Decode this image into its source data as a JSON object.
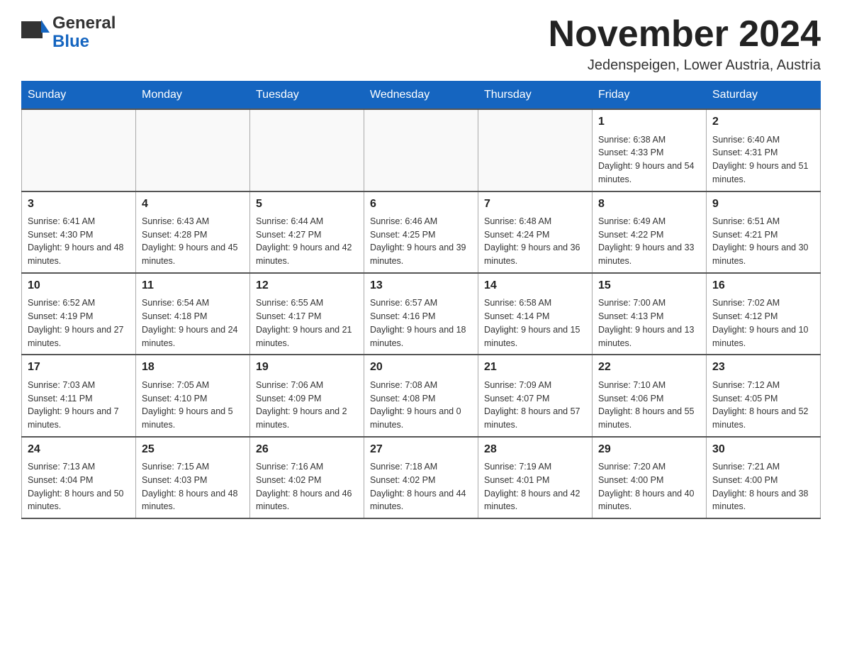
{
  "header": {
    "logo_text_general": "General",
    "logo_text_blue": "Blue",
    "month_year": "November 2024",
    "location": "Jedenspeigen, Lower Austria, Austria"
  },
  "weekdays": [
    "Sunday",
    "Monday",
    "Tuesday",
    "Wednesday",
    "Thursday",
    "Friday",
    "Saturday"
  ],
  "weeks": [
    {
      "days": [
        {
          "num": "",
          "info": ""
        },
        {
          "num": "",
          "info": ""
        },
        {
          "num": "",
          "info": ""
        },
        {
          "num": "",
          "info": ""
        },
        {
          "num": "",
          "info": ""
        },
        {
          "num": "1",
          "info": "Sunrise: 6:38 AM\nSunset: 4:33 PM\nDaylight: 9 hours and 54 minutes."
        },
        {
          "num": "2",
          "info": "Sunrise: 6:40 AM\nSunset: 4:31 PM\nDaylight: 9 hours and 51 minutes."
        }
      ]
    },
    {
      "days": [
        {
          "num": "3",
          "info": "Sunrise: 6:41 AM\nSunset: 4:30 PM\nDaylight: 9 hours and 48 minutes."
        },
        {
          "num": "4",
          "info": "Sunrise: 6:43 AM\nSunset: 4:28 PM\nDaylight: 9 hours and 45 minutes."
        },
        {
          "num": "5",
          "info": "Sunrise: 6:44 AM\nSunset: 4:27 PM\nDaylight: 9 hours and 42 minutes."
        },
        {
          "num": "6",
          "info": "Sunrise: 6:46 AM\nSunset: 4:25 PM\nDaylight: 9 hours and 39 minutes."
        },
        {
          "num": "7",
          "info": "Sunrise: 6:48 AM\nSunset: 4:24 PM\nDaylight: 9 hours and 36 minutes."
        },
        {
          "num": "8",
          "info": "Sunrise: 6:49 AM\nSunset: 4:22 PM\nDaylight: 9 hours and 33 minutes."
        },
        {
          "num": "9",
          "info": "Sunrise: 6:51 AM\nSunset: 4:21 PM\nDaylight: 9 hours and 30 minutes."
        }
      ]
    },
    {
      "days": [
        {
          "num": "10",
          "info": "Sunrise: 6:52 AM\nSunset: 4:19 PM\nDaylight: 9 hours and 27 minutes."
        },
        {
          "num": "11",
          "info": "Sunrise: 6:54 AM\nSunset: 4:18 PM\nDaylight: 9 hours and 24 minutes."
        },
        {
          "num": "12",
          "info": "Sunrise: 6:55 AM\nSunset: 4:17 PM\nDaylight: 9 hours and 21 minutes."
        },
        {
          "num": "13",
          "info": "Sunrise: 6:57 AM\nSunset: 4:16 PM\nDaylight: 9 hours and 18 minutes."
        },
        {
          "num": "14",
          "info": "Sunrise: 6:58 AM\nSunset: 4:14 PM\nDaylight: 9 hours and 15 minutes."
        },
        {
          "num": "15",
          "info": "Sunrise: 7:00 AM\nSunset: 4:13 PM\nDaylight: 9 hours and 13 minutes."
        },
        {
          "num": "16",
          "info": "Sunrise: 7:02 AM\nSunset: 4:12 PM\nDaylight: 9 hours and 10 minutes."
        }
      ]
    },
    {
      "days": [
        {
          "num": "17",
          "info": "Sunrise: 7:03 AM\nSunset: 4:11 PM\nDaylight: 9 hours and 7 minutes."
        },
        {
          "num": "18",
          "info": "Sunrise: 7:05 AM\nSunset: 4:10 PM\nDaylight: 9 hours and 5 minutes."
        },
        {
          "num": "19",
          "info": "Sunrise: 7:06 AM\nSunset: 4:09 PM\nDaylight: 9 hours and 2 minutes."
        },
        {
          "num": "20",
          "info": "Sunrise: 7:08 AM\nSunset: 4:08 PM\nDaylight: 9 hours and 0 minutes."
        },
        {
          "num": "21",
          "info": "Sunrise: 7:09 AM\nSunset: 4:07 PM\nDaylight: 8 hours and 57 minutes."
        },
        {
          "num": "22",
          "info": "Sunrise: 7:10 AM\nSunset: 4:06 PM\nDaylight: 8 hours and 55 minutes."
        },
        {
          "num": "23",
          "info": "Sunrise: 7:12 AM\nSunset: 4:05 PM\nDaylight: 8 hours and 52 minutes."
        }
      ]
    },
    {
      "days": [
        {
          "num": "24",
          "info": "Sunrise: 7:13 AM\nSunset: 4:04 PM\nDaylight: 8 hours and 50 minutes."
        },
        {
          "num": "25",
          "info": "Sunrise: 7:15 AM\nSunset: 4:03 PM\nDaylight: 8 hours and 48 minutes."
        },
        {
          "num": "26",
          "info": "Sunrise: 7:16 AM\nSunset: 4:02 PM\nDaylight: 8 hours and 46 minutes."
        },
        {
          "num": "27",
          "info": "Sunrise: 7:18 AM\nSunset: 4:02 PM\nDaylight: 8 hours and 44 minutes."
        },
        {
          "num": "28",
          "info": "Sunrise: 7:19 AM\nSunset: 4:01 PM\nDaylight: 8 hours and 42 minutes."
        },
        {
          "num": "29",
          "info": "Sunrise: 7:20 AM\nSunset: 4:00 PM\nDaylight: 8 hours and 40 minutes."
        },
        {
          "num": "30",
          "info": "Sunrise: 7:21 AM\nSunset: 4:00 PM\nDaylight: 8 hours and 38 minutes."
        }
      ]
    }
  ]
}
